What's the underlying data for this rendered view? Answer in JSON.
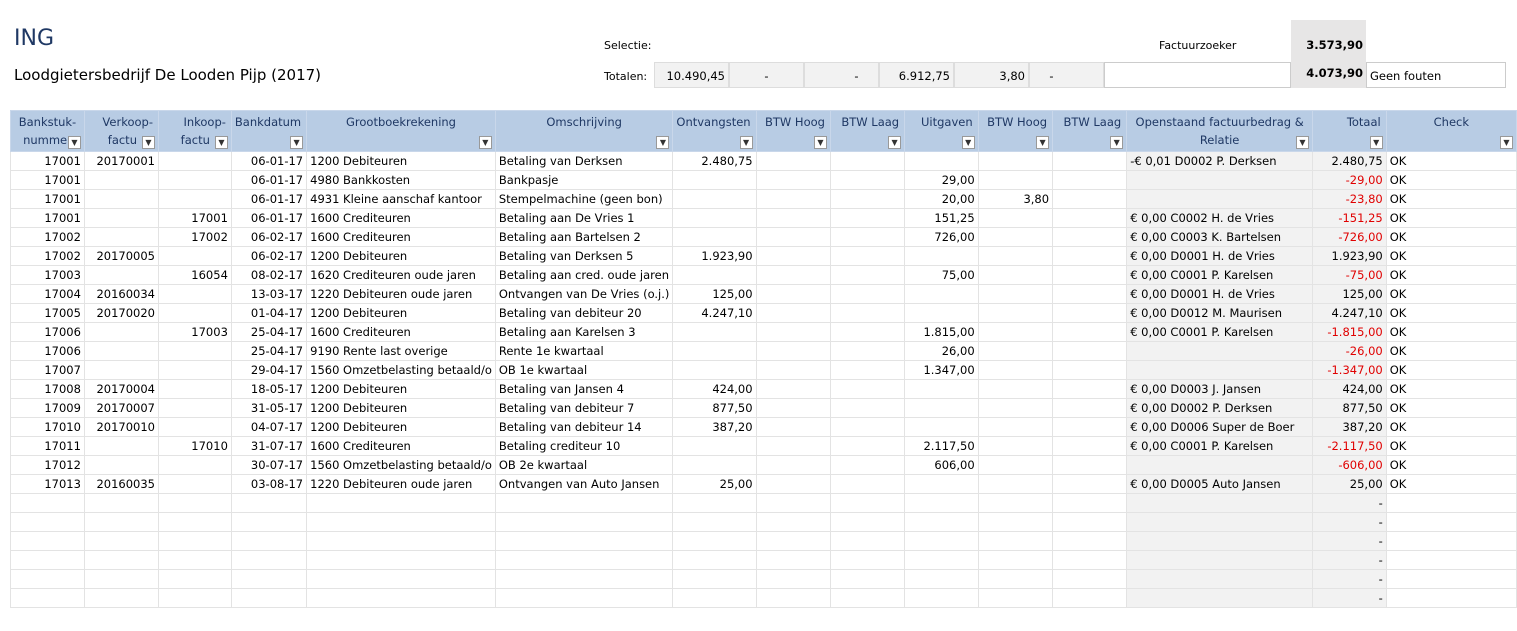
{
  "title": "ING",
  "subtitle": "Loodgietersbedrijf De Looden Pijp (2017)",
  "labels": {
    "selectie": "Selectie:",
    "totalen": "Totalen:",
    "factuurzoeker": "Factuurzoeker",
    "factuurzoeker_value": "3.573,90",
    "total_value": "4.073,90",
    "status": "Geen fouten"
  },
  "totals": {
    "ontvangsten": "10.490,45",
    "btw_hoog_in": "-",
    "btw_laag_in": "-",
    "uitgaven": "6.912,75",
    "btw_hoog_out": "3,80",
    "btw_laag_out": "-"
  },
  "headers": [
    {
      "l1": "Bankstuk-",
      "l2": "nummer",
      "align": "l"
    },
    {
      "l1": "Verkoop-",
      "l2": "factu",
      "align": "r"
    },
    {
      "l1": "Inkoop-",
      "l2": "factu",
      "align": "r"
    },
    {
      "l1": "Bankdatum",
      "l2": "",
      "align": "r"
    },
    {
      "l1": "Grootboekrekening",
      "l2": "",
      "align": "l"
    },
    {
      "l1": "Omschrijving",
      "l2": "",
      "align": "l"
    },
    {
      "l1": "Ontvangsten",
      "l2": "",
      "align": "r"
    },
    {
      "l1": "BTW Hoog",
      "l2": "",
      "align": "r"
    },
    {
      "l1": "BTW Laag",
      "l2": "",
      "align": "r"
    },
    {
      "l1": "Uitgaven",
      "l2": "",
      "align": "r"
    },
    {
      "l1": "BTW Hoog",
      "l2": "",
      "align": "r"
    },
    {
      "l1": "BTW Laag",
      "l2": "",
      "align": "r"
    },
    {
      "l1": "Openstaand factuurbedrag &",
      "l2": "Relatie",
      "align": "l"
    },
    {
      "l1": "Totaal",
      "l2": "",
      "align": "r"
    },
    {
      "l1": "Check",
      "l2": "",
      "align": "l"
    }
  ],
  "filter_glyph": "▼",
  "rows": [
    [
      "17001",
      "20170001",
      "",
      "06-01-17",
      "1200 Debiteuren",
      "Betaling van Derksen",
      "2.480,75",
      "",
      "",
      "",
      "",
      "",
      "-€ 0,01 D0002 P. Derksen",
      "2.480,75",
      "OK"
    ],
    [
      "17001",
      "",
      "",
      "06-01-17",
      "4980 Bankkosten",
      "Bankpasje",
      "",
      "",
      "",
      "29,00",
      "",
      "",
      "",
      "-29,00",
      "OK"
    ],
    [
      "17001",
      "",
      "",
      "06-01-17",
      "4931 Kleine aanschaf kantoor",
      "Stempelmachine (geen bon)",
      "",
      "",
      "",
      "20,00",
      "3,80",
      "",
      "",
      "-23,80",
      "OK"
    ],
    [
      "17001",
      "",
      "17001",
      "06-01-17",
      "1600 Crediteuren",
      "Betaling aan De Vries 1",
      "",
      "",
      "",
      "151,25",
      "",
      "",
      "€ 0,00 C0002 H. de Vries",
      "-151,25",
      "OK"
    ],
    [
      "17002",
      "",
      "17002",
      "06-02-17",
      "1600 Crediteuren",
      "Betaling aan Bartelsen 2",
      "",
      "",
      "",
      "726,00",
      "",
      "",
      "€ 0,00 C0003 K. Bartelsen",
      "-726,00",
      "OK"
    ],
    [
      "17002",
      "20170005",
      "",
      "06-02-17",
      "1200 Debiteuren",
      "Betaling van Derksen 5",
      "1.923,90",
      "",
      "",
      "",
      "",
      "",
      "€ 0,00 D0001 H. de Vries",
      "1.923,90",
      "OK"
    ],
    [
      "17003",
      "",
      "16054",
      "08-02-17",
      "1620 Crediteuren oude jaren",
      "Betaling aan cred. oude jaren",
      "",
      "",
      "",
      "75,00",
      "",
      "",
      "€ 0,00 C0001 P. Karelsen",
      "-75,00",
      "OK"
    ],
    [
      "17004",
      "20160034",
      "",
      "13-03-17",
      "1220 Debiteuren oude jaren",
      "Ontvangen van De Vries (o.j.)",
      "125,00",
      "",
      "",
      "",
      "",
      "",
      "€ 0,00 D0001 H. de Vries",
      "125,00",
      "OK"
    ],
    [
      "17005",
      "20170020",
      "",
      "01-04-17",
      "1200 Debiteuren",
      "Betaling van debiteur 20",
      "4.247,10",
      "",
      "",
      "",
      "",
      "",
      "€ 0,00 D0012 M. Maurisen",
      "4.247,10",
      "OK"
    ],
    [
      "17006",
      "",
      "17003",
      "25-04-17",
      "1600 Crediteuren",
      "Betaling aan Karelsen 3",
      "",
      "",
      "",
      "1.815,00",
      "",
      "",
      "€ 0,00 C0001 P. Karelsen",
      "-1.815,00",
      "OK"
    ],
    [
      "17006",
      "",
      "",
      "25-04-17",
      "9190 Rente last overige",
      "Rente 1e kwartaal",
      "",
      "",
      "",
      "26,00",
      "",
      "",
      "",
      "-26,00",
      "OK"
    ],
    [
      "17007",
      "",
      "",
      "29-04-17",
      "1560 Omzetbelasting betaald/o",
      "OB 1e kwartaal",
      "",
      "",
      "",
      "1.347,00",
      "",
      "",
      "",
      "-1.347,00",
      "OK"
    ],
    [
      "17008",
      "20170004",
      "",
      "18-05-17",
      "1200 Debiteuren",
      "Betaling van Jansen 4",
      "424,00",
      "",
      "",
      "",
      "",
      "",
      "€ 0,00 D0003 J. Jansen",
      "424,00",
      "OK"
    ],
    [
      "17009",
      "20170007",
      "",
      "31-05-17",
      "1200 Debiteuren",
      "Betaling van debiteur 7",
      "877,50",
      "",
      "",
      "",
      "",
      "",
      "€ 0,00 D0002 P. Derksen",
      "877,50",
      "OK"
    ],
    [
      "17010",
      "20170010",
      "",
      "04-07-17",
      "1200 Debiteuren",
      "Betaling van debiteur 14",
      "387,20",
      "",
      "",
      "",
      "",
      "",
      "€ 0,00 D0006 Super de Boer",
      "387,20",
      "OK"
    ],
    [
      "17011",
      "",
      "17010",
      "31-07-17",
      "1600 Crediteuren",
      "Betaling crediteur 10",
      "",
      "",
      "",
      "2.117,50",
      "",
      "",
      "€ 0,00 C0001 P. Karelsen",
      "-2.117,50",
      "OK"
    ],
    [
      "17012",
      "",
      "",
      "30-07-17",
      "1560 Omzetbelasting betaald/o",
      "OB 2e kwartaal",
      "",
      "",
      "",
      "606,00",
      "",
      "",
      "",
      "-606,00",
      "OK"
    ],
    [
      "17013",
      "20160035",
      "",
      "03-08-17",
      "1220 Debiteuren oude jaren",
      "Ontvangen van Auto Jansen",
      "25,00",
      "",
      "",
      "",
      "",
      "",
      "€ 0,00 D0005 Auto Jansen",
      "25,00",
      "OK"
    ],
    [
      "",
      "",
      "",
      "",
      "",
      "",
      "",
      "",
      "",
      "",
      "",
      "",
      "",
      "-",
      ""
    ],
    [
      "",
      "",
      "",
      "",
      "",
      "",
      "",
      "",
      "",
      "",
      "",
      "",
      "",
      "-",
      ""
    ],
    [
      "",
      "",
      "",
      "",
      "",
      "",
      "",
      "",
      "",
      "",
      "",
      "",
      "",
      "-",
      ""
    ],
    [
      "",
      "",
      "",
      "",
      "",
      "",
      "",
      "",
      "",
      "",
      "",
      "",
      "",
      "-",
      ""
    ],
    [
      "",
      "",
      "",
      "",
      "",
      "",
      "",
      "",
      "",
      "",
      "",
      "",
      "",
      "-",
      ""
    ],
    [
      "",
      "",
      "",
      "",
      "",
      "",
      "",
      "",
      "",
      "",
      "",
      "",
      "",
      "-",
      ""
    ]
  ]
}
